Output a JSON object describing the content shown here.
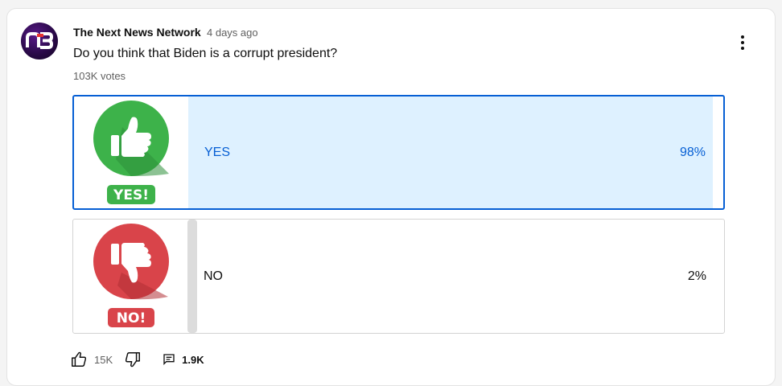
{
  "post": {
    "channel_name": "The Next News Network",
    "channel_avatar_text": "n3",
    "time_ago": "4 days ago",
    "question": "Do you think that Biden is a corrupt president?",
    "votes": "103K votes"
  },
  "poll": {
    "options": [
      {
        "label": "YES",
        "percent": "98%",
        "fraction": 0.98,
        "selected": true,
        "badge_text": "YES!",
        "icon": "thumbs-up-icon",
        "badge_color": "#3db24a"
      },
      {
        "label": "NO",
        "percent": "2%",
        "fraction": 0.02,
        "selected": false,
        "badge_text": "NO!",
        "icon": "thumbs-down-icon",
        "badge_color": "#d9444a"
      }
    ]
  },
  "actions": {
    "like_count": "15K",
    "comment_count": "1.9K"
  },
  "colors": {
    "accent": "#065fd4",
    "selected_fill": "#def1ff",
    "secondary_text": "#606060"
  }
}
